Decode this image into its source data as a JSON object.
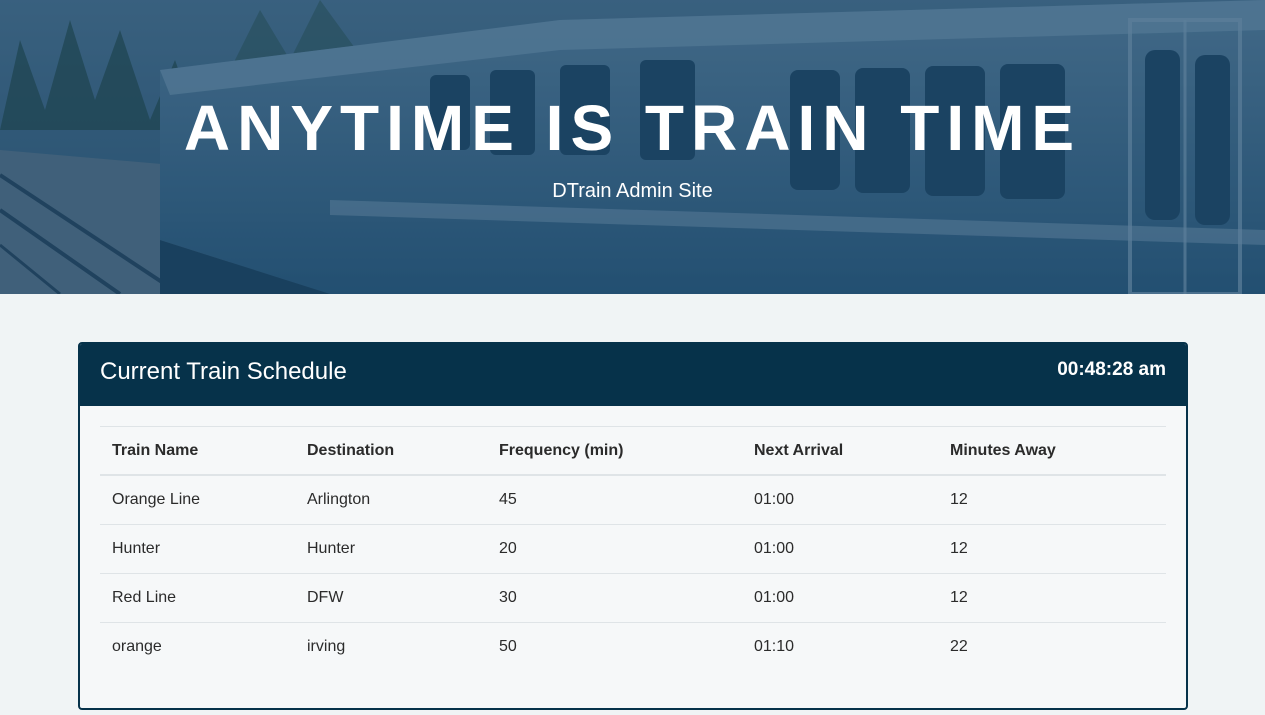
{
  "hero": {
    "title": "ANYTIME IS TRAIN TIME",
    "subtitle": "DTrain Admin Site",
    "image": "train-photo"
  },
  "schedule": {
    "title": "Current Train Schedule",
    "clock": "00:48:28 am",
    "columns": [
      "Train Name",
      "Destination",
      "Frequency (min)",
      "Next Arrival",
      "Minutes Away"
    ],
    "rows": [
      [
        "Orange Line",
        "Arlington",
        "45",
        "01:00",
        "12"
      ],
      [
        "Hunter",
        "Hunter",
        "20",
        "01:00",
        "12"
      ],
      [
        "Red Line",
        "DFW",
        "30",
        "01:00",
        "12"
      ],
      [
        "orange",
        "irving",
        "50",
        "01:10",
        "22"
      ]
    ]
  },
  "colors": {
    "panel_header": "#06324a",
    "page_background": "#f0f4f5",
    "hero_overlay": "#1f4d6e"
  }
}
